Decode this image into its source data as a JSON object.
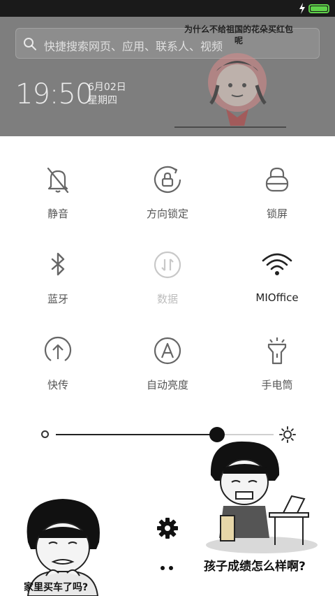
{
  "lock_overlay": {
    "search_placeholder": "快捷搜索网页、应用、联系人、视频",
    "time": "19:50",
    "date": "6月02日",
    "weekday": "星期四",
    "meme_caption": "为什么不给祖国的花朵买红包呢"
  },
  "status_bar": {
    "charging_icon": "bolt-icon",
    "battery_level_percent": 100,
    "battery_color": "#5fd24a"
  },
  "toggles": [
    {
      "label": "静音",
      "icon": "bell-off-icon",
      "state": "off"
    },
    {
      "label": "方向锁定",
      "icon": "rotation-lock-icon",
      "state": "off"
    },
    {
      "label": "锁屏",
      "icon": "lock-icon",
      "state": "off"
    },
    {
      "label": "蓝牙",
      "icon": "bluetooth-icon",
      "state": "off"
    },
    {
      "label": "数据",
      "icon": "mobile-data-icon",
      "state": "disabled"
    },
    {
      "label": "MIOffice",
      "icon": "wifi-icon",
      "state": "on"
    },
    {
      "label": "快传",
      "icon": "quick-transfer-icon",
      "state": "off"
    },
    {
      "label": "自动亮度",
      "icon": "auto-brightness-icon",
      "state": "off"
    },
    {
      "label": "手电筒",
      "icon": "flashlight-icon",
      "state": "off"
    }
  ],
  "brightness": {
    "level_percent": 74,
    "min_icon": "brightness-low-icon",
    "max_icon": "brightness-high-icon"
  },
  "bottom": {
    "settings_icon": "gear-icon",
    "page_count": 2
  },
  "memes": {
    "left_caption": "家里买车了吗?",
    "right_caption": "孩子成绩怎么样啊?"
  }
}
